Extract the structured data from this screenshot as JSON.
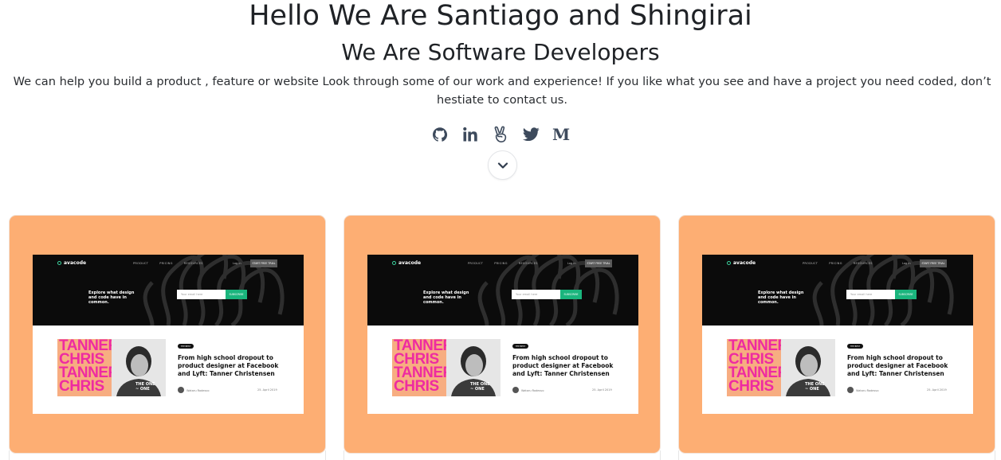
{
  "hero": {
    "title": "Hello We Are Santiago and Shingirai",
    "subtitle": "We Are Software Developers",
    "blurb": "We can help you build a product , feature or website Look through some of our work and experience! If you like what you see and have a project you need coded, don’t hestiate to contact us."
  },
  "socials": [
    {
      "icon": "github-icon"
    },
    {
      "icon": "linkedin-icon"
    },
    {
      "icon": "angellist-icon"
    },
    {
      "icon": "twitter-icon"
    },
    {
      "icon": "medium-icon",
      "glyph": "M"
    }
  ],
  "scroll_button": {
    "icon": "chevron-down-icon"
  },
  "colors": {
    "card_bg": "#fdae73",
    "icon": "#3d4a5c",
    "accent_pink": "#ee2ba1",
    "accent_green": "#1ab57d"
  },
  "cards": [
    {
      "preview": {
        "logo": "avacode",
        "nav": [
          "PRODUCT",
          "PRICING",
          "RESOURCES"
        ],
        "login": "Log in",
        "cta": "START FREE TRIAL",
        "hero_text": "Explore what design and code have in common.",
        "email_placeholder": "Your email here",
        "subscribe": "SUBSCRIBE",
        "tag": "THE BEST",
        "image_words": [
          "TANNER",
          "CHRIS",
          "TANNER",
          "CHRIS"
        ],
        "image_caption": "THE ONE ~ ONE",
        "headline": "From high school dropout to product designer at Facebook and Lyft: Tanner Christensen",
        "author": "Wataru Rodesvo",
        "date": "25. April 2019"
      }
    },
    {
      "preview": {
        "logo": "avacode",
        "nav": [
          "PRODUCT",
          "PRICING",
          "RESOURCES"
        ],
        "login": "Log in",
        "cta": "START FREE TRIAL",
        "hero_text": "Explore what design and code have in common.",
        "email_placeholder": "Your email here",
        "subscribe": "SUBSCRIBE",
        "tag": "THE BEST",
        "image_words": [
          "TANNER",
          "CHRIS",
          "TANNER",
          "CHRIS"
        ],
        "image_caption": "THE ONE ~ ONE",
        "headline": "From high school dropout to product designer at Facebook and Lyft: Tanner Christensen",
        "author": "Wataru Rodesvo",
        "date": "25. April 2019"
      }
    },
    {
      "preview": {
        "logo": "avacode",
        "nav": [
          "PRODUCT",
          "PRICING",
          "RESOURCES"
        ],
        "login": "Log in",
        "cta": "START FREE TRIAL",
        "hero_text": "Explore what design and code have in common.",
        "email_placeholder": "Your email here",
        "subscribe": "SUBSCRIBE",
        "tag": "THE BEST",
        "image_words": [
          "TANNER",
          "CHRIS",
          "TANNER",
          "CHRIS"
        ],
        "image_caption": "THE ONE ~ ONE",
        "headline": "From high school dropout to product designer at Facebook and Lyft: Tanner Christensen",
        "author": "Wataru Rodesvo",
        "date": "25. April 2019"
      }
    }
  ]
}
